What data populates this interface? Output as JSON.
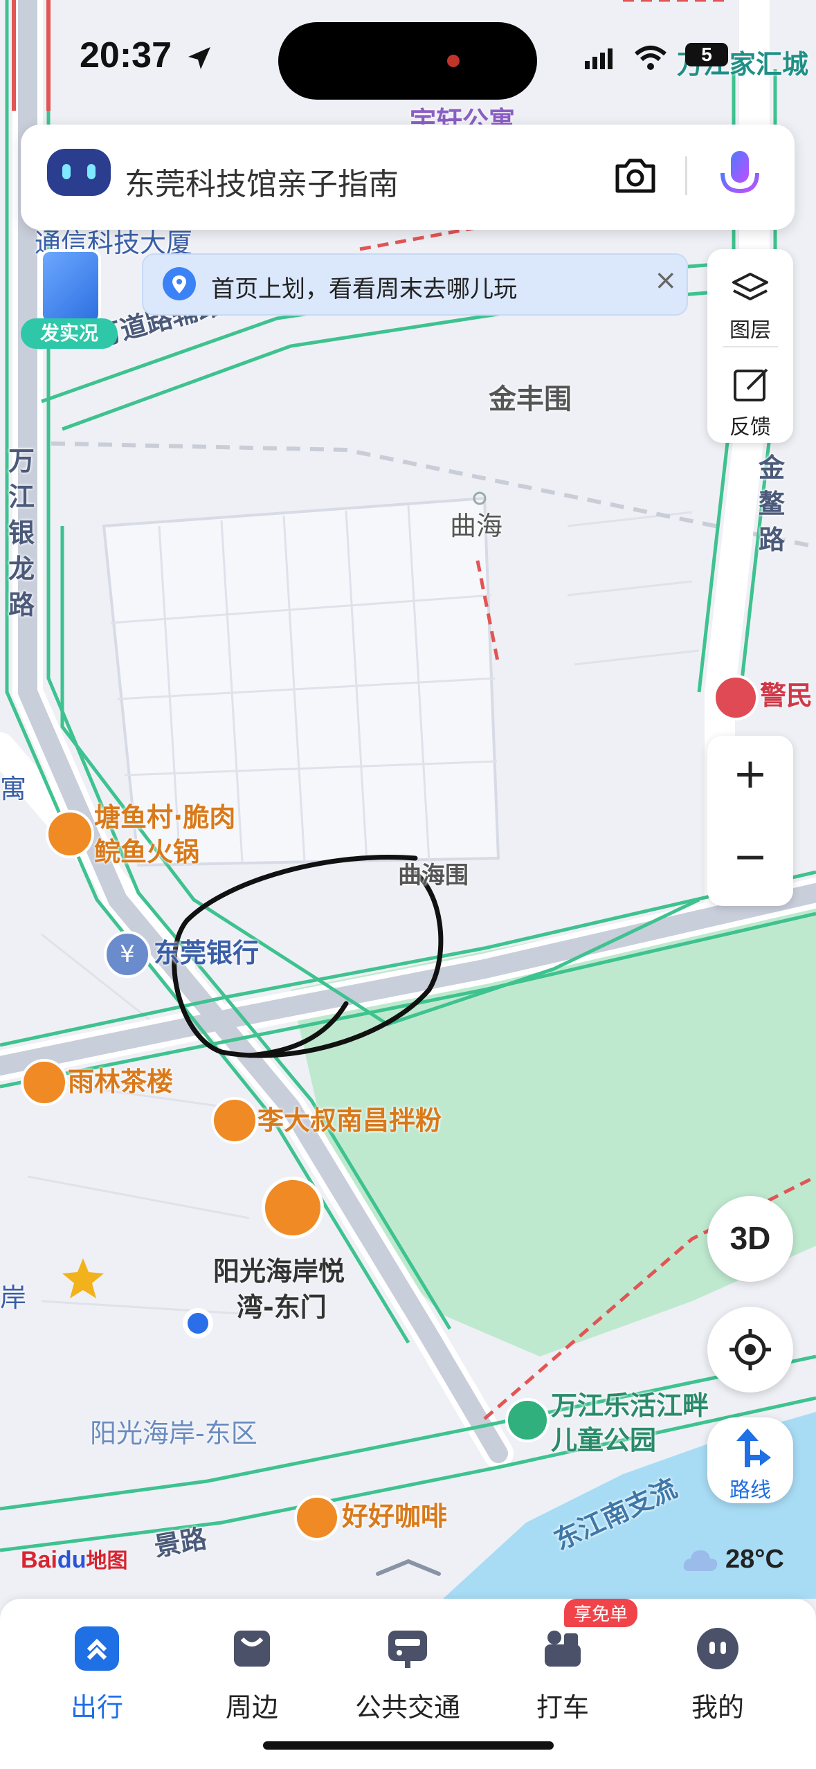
{
  "status": {
    "time": "20:37",
    "battery": "5"
  },
  "search": {
    "placeholder": "东莞科技馆亲子指南"
  },
  "notice": {
    "text": "首页上划，看看周末去哪儿玩"
  },
  "live_badge": "发实况",
  "right_panel": {
    "layers_label": "图层",
    "feedback_label": "反馈"
  },
  "zoom": {
    "in": "+",
    "out": "−"
  },
  "buttons": {
    "view3d": "3D",
    "route": "路线"
  },
  "weather": {
    "temp": "28°C"
  },
  "logo": {
    "baidu": "Bai",
    "map": "地图"
  },
  "map_labels": {
    "top_right_poi": "万江家汇城",
    "top_center_poi": "宇轩公寓",
    "tongxin": "通信科技大厦",
    "wandao_road": "万道路辅路",
    "jinfeng": "金丰围",
    "wanjiang_yinlong": "万江银龙路",
    "jinao": "金鳌路",
    "quhai_station": "曲海",
    "jingmin": "警民",
    "tangyu": [
      "塘鱼村·脆肉",
      "鲩鱼火锅"
    ],
    "quhaiwei": "曲海围",
    "dongguan_bank": "东莞银行",
    "yulin": "雨林茶楼",
    "li_dashu": "李大叔南昌拌粉",
    "yangguang_gate": [
      "阳光海岸悦",
      "湾-东门"
    ],
    "yangguang_east": "阳光海岸-东区",
    "wanjiang_park": [
      "万江乐活江畔",
      "儿童公园"
    ],
    "haohao": "好好咖啡",
    "jing_road": "景路",
    "dongjiang": "东江南支流",
    "left_edge_1": "寓",
    "left_edge_2": "岸"
  },
  "tabs": [
    {
      "label": "出行",
      "active": true
    },
    {
      "label": "周边",
      "active": false
    },
    {
      "label": "公共交通",
      "active": false
    },
    {
      "label": "打车",
      "active": false,
      "badge": "享免单"
    },
    {
      "label": "我的",
      "active": false
    }
  ],
  "colors": {
    "accent": "#1f6fe5",
    "road_green": "#3ec28f",
    "water": "#a8dcf5",
    "park": "#bfe9cf",
    "poi_orange": "#f08a24"
  }
}
